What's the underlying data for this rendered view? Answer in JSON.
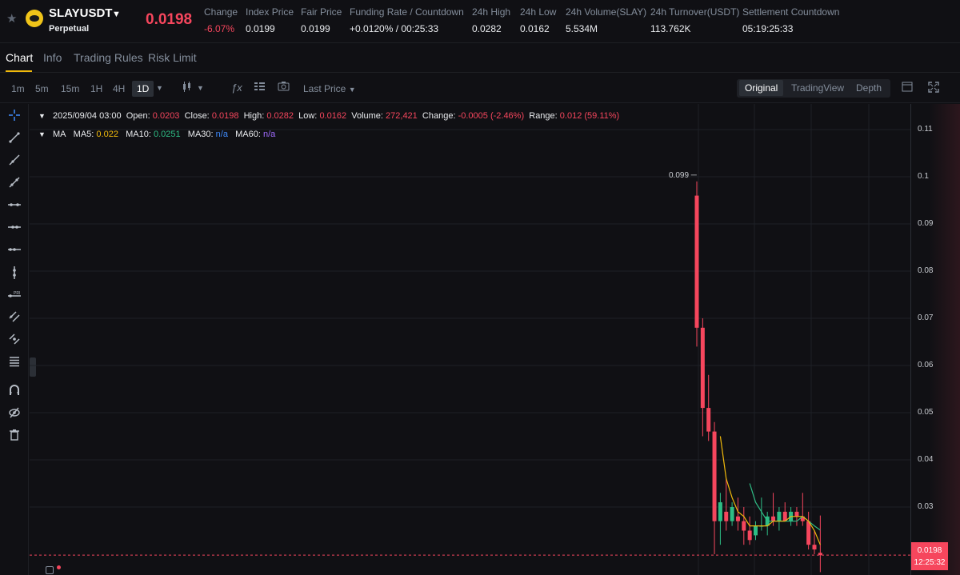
{
  "header": {
    "symbol": "SLAYUSDT",
    "contract_type": "Perpetual",
    "last_price": "0.0198",
    "stats": [
      {
        "label": "Change",
        "value": "-6.07%",
        "color": "#f6465d"
      },
      {
        "label": "Index Price",
        "value": "0.0199"
      },
      {
        "label": "Fair Price",
        "value": "0.0199"
      },
      {
        "label": "Funding Rate / Countdown",
        "value": "+0.0120% / 00:25:33"
      },
      {
        "label": "24h High",
        "value": "0.0282"
      },
      {
        "label": "24h Low",
        "value": "0.0162"
      },
      {
        "label": "24h Volume(SLAY)",
        "value": "5.534M"
      },
      {
        "label": "24h Turnover(USDT)",
        "value": "113.762K"
      },
      {
        "label": "Settlement Countdown",
        "value": "05:19:25:33"
      }
    ]
  },
  "tabs": [
    "Chart",
    "Info",
    "Trading Rules",
    "Risk Limit"
  ],
  "toolbar": {
    "timeframes": [
      "1m",
      "5m",
      "15m",
      "1H",
      "4H",
      "1D"
    ],
    "active_timeframe": "1D",
    "price_type": "Last Price",
    "views": [
      "Original",
      "TradingView",
      "Depth"
    ],
    "active_view": "Original"
  },
  "legend": {
    "date": "2025/09/04 03:00",
    "open_label": "Open:",
    "open": "0.0203",
    "close_label": "Close:",
    "close": "0.0198",
    "high_label": "High:",
    "high": "0.0282",
    "low_label": "Low:",
    "low": "0.0162",
    "volume_label": "Volume:",
    "volume": "272,421",
    "change_label": "Change:",
    "change": "-0.0005 (-2.46%)",
    "range_label": "Range:",
    "range": "0.012 (59.11%)",
    "ma_title": "MA",
    "ma5_label": "MA5:",
    "ma5": "0.022",
    "ma10_label": "MA10:",
    "ma10": "0.0251",
    "ma30_label": "MA30:",
    "ma30": "n/a",
    "ma60_label": "MA60:",
    "ma60": "n/a"
  },
  "price_axis": {
    "ticks": [
      "0.11",
      "0.1",
      "0.09",
      "0.08",
      "0.07",
      "0.06",
      "0.05",
      "0.04",
      "0.03"
    ],
    "current_price": "0.0198",
    "countdown": "12:25:32",
    "high_marker": "0.099"
  },
  "colors": {
    "up": "#2ebd85",
    "down": "#f6465d",
    "ma5": "#f0b90b",
    "ma10": "#2ebd85",
    "accent": "#f0b90b",
    "tool_active": "#3f8cff"
  },
  "chart_data": {
    "type": "candlestick",
    "ylim": [
      0.015,
      0.113
    ],
    "candles": [
      {
        "o": 0.096,
        "h": 0.099,
        "l": 0.064,
        "c": 0.068
      },
      {
        "o": 0.068,
        "h": 0.07,
        "l": 0.045,
        "c": 0.051
      },
      {
        "o": 0.051,
        "h": 0.058,
        "l": 0.044,
        "c": 0.046
      },
      {
        "o": 0.046,
        "h": 0.048,
        "l": 0.02,
        "c": 0.027
      },
      {
        "o": 0.027,
        "h": 0.033,
        "l": 0.022,
        "c": 0.031
      },
      {
        "o": 0.029,
        "h": 0.036,
        "l": 0.025,
        "c": 0.027
      },
      {
        "o": 0.027,
        "h": 0.031,
        "l": 0.026,
        "c": 0.03
      },
      {
        "o": 0.028,
        "h": 0.032,
        "l": 0.025,
        "c": 0.027
      },
      {
        "o": 0.027,
        "h": 0.03,
        "l": 0.022,
        "c": 0.025
      },
      {
        "o": 0.025,
        "h": 0.028,
        "l": 0.022,
        "c": 0.023
      },
      {
        "o": 0.024,
        "h": 0.027,
        "l": 0.023,
        "c": 0.026
      },
      {
        "o": 0.026,
        "h": 0.032,
        "l": 0.025,
        "c": 0.026
      },
      {
        "o": 0.026,
        "h": 0.029,
        "l": 0.024,
        "c": 0.028
      },
      {
        "o": 0.028,
        "h": 0.033,
        "l": 0.026,
        "c": 0.027
      },
      {
        "o": 0.027,
        "h": 0.03,
        "l": 0.025,
        "c": 0.029
      },
      {
        "o": 0.029,
        "h": 0.031,
        "l": 0.027,
        "c": 0.027
      },
      {
        "o": 0.027,
        "h": 0.03,
        "l": 0.026,
        "c": 0.029
      },
      {
        "o": 0.029,
        "h": 0.03,
        "l": 0.026,
        "c": 0.028
      },
      {
        "o": 0.028,
        "h": 0.033,
        "l": 0.026,
        "c": 0.027
      },
      {
        "o": 0.027,
        "h": 0.029,
        "l": 0.021,
        "c": 0.022
      },
      {
        "o": 0.022,
        "h": 0.025,
        "l": 0.02,
        "c": 0.021
      },
      {
        "o": 0.0203,
        "h": 0.0282,
        "l": 0.0162,
        "c": 0.0198
      }
    ],
    "ma5": [
      null,
      null,
      null,
      null,
      0.045,
      0.036,
      0.032,
      0.029,
      0.028,
      0.026,
      0.026,
      0.026,
      0.026,
      0.027,
      0.027,
      0.027,
      0.028,
      0.028,
      0.028,
      0.027,
      0.025,
      0.022
    ],
    "ma10": [
      null,
      null,
      null,
      null,
      null,
      null,
      null,
      null,
      null,
      0.035,
      0.031,
      0.029,
      0.027,
      0.027,
      0.027,
      0.027,
      0.027,
      0.027,
      0.028,
      0.027,
      0.026,
      0.0251
    ]
  }
}
